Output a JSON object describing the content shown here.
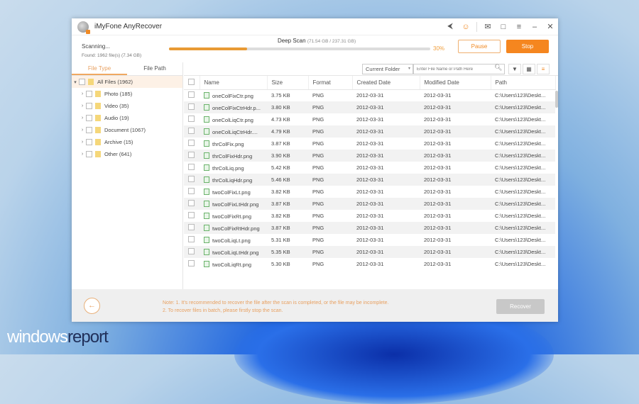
{
  "app": {
    "title": "iMyFone AnyRecover"
  },
  "titlebar_icons": [
    "share-icon",
    "user-icon",
    "mail-icon",
    "feedback-icon",
    "menu-icon",
    "minimize-icon",
    "close-icon"
  ],
  "scan": {
    "status": "Scanning...",
    "found": "Found: 1962 file(s) (7.34 GB)",
    "mode": "Deep Scan",
    "progress_text": "(71.54 GB / 237.31 GB)",
    "percent_label": "30%",
    "percent": 30,
    "pause": "Pause",
    "stop": "Stop"
  },
  "sidebar": {
    "tabs": [
      "File Type",
      "File Path"
    ],
    "root": "All Files (1962)",
    "items": [
      "Photo (185)",
      "Video (35)",
      "Audio (19)",
      "Document (1067)",
      "Archive (15)",
      "Other (641)"
    ]
  },
  "toolbar": {
    "folder": "Current Folder",
    "search_placeholder": "Enter File Name or Path Here"
  },
  "table": {
    "headers": [
      "Name",
      "Size",
      "Format",
      "Created Date",
      "Modified Date",
      "Path"
    ],
    "rows": [
      [
        "oneColFixCtr.png",
        "3.75 KB",
        "PNG",
        "2012-03-31",
        "2012-03-31",
        "C:\\Users\\123\\Deskt..."
      ],
      [
        "oneColFixCtrHdr.p...",
        "3.80 KB",
        "PNG",
        "2012-03-31",
        "2012-03-31",
        "C:\\Users\\123\\Deskt..."
      ],
      [
        "oneColLiqCtr.png",
        "4.73 KB",
        "PNG",
        "2012-03-31",
        "2012-03-31",
        "C:\\Users\\123\\Deskt..."
      ],
      [
        "oneColLiqCtrHdr....",
        "4.79 KB",
        "PNG",
        "2012-03-31",
        "2012-03-31",
        "C:\\Users\\123\\Deskt..."
      ],
      [
        "thrColFix.png",
        "3.87 KB",
        "PNG",
        "2012-03-31",
        "2012-03-31",
        "C:\\Users\\123\\Deskt..."
      ],
      [
        "thrColFixHdr.png",
        "3.90 KB",
        "PNG",
        "2012-03-31",
        "2012-03-31",
        "C:\\Users\\123\\Deskt..."
      ],
      [
        "thrColLiq.png",
        "5.42 KB",
        "PNG",
        "2012-03-31",
        "2012-03-31",
        "C:\\Users\\123\\Deskt..."
      ],
      [
        "thrColLiqHdr.png",
        "5.46 KB",
        "PNG",
        "2012-03-31",
        "2012-03-31",
        "C:\\Users\\123\\Deskt..."
      ],
      [
        "twoColFixLt.png",
        "3.82 KB",
        "PNG",
        "2012-03-31",
        "2012-03-31",
        "C:\\Users\\123\\Deskt..."
      ],
      [
        "twoColFixLtHdr.png",
        "3.87 KB",
        "PNG",
        "2012-03-31",
        "2012-03-31",
        "C:\\Users\\123\\Deskt..."
      ],
      [
        "twoColFixRt.png",
        "3.82 KB",
        "PNG",
        "2012-03-31",
        "2012-03-31",
        "C:\\Users\\123\\Deskt..."
      ],
      [
        "twoColFixRtHdr.png",
        "3.87 KB",
        "PNG",
        "2012-03-31",
        "2012-03-31",
        "C:\\Users\\123\\Deskt..."
      ],
      [
        "twoColLiqLt.png",
        "5.31 KB",
        "PNG",
        "2012-03-31",
        "2012-03-31",
        "C:\\Users\\123\\Deskt..."
      ],
      [
        "twoColLiqLtHdr.png",
        "5.35 KB",
        "PNG",
        "2012-03-31",
        "2012-03-31",
        "C:\\Users\\123\\Deskt..."
      ],
      [
        "twoColLiqRt.png",
        "5.30 KB",
        "PNG",
        "2012-03-31",
        "2012-03-31",
        "C:\\Users\\123\\Deskt..."
      ]
    ]
  },
  "footer": {
    "note1": "Note: 1. It's recommended to recover the file after the scan is completed, or the file may be incomplete.",
    "note2": "2. To recover files in batch, please firstly stop the scan.",
    "recover": "Recover"
  },
  "watermark": {
    "part1": "windows",
    "part2": "report"
  },
  "colors": {
    "accent": "#f5861f",
    "progress": "#e89a34"
  }
}
